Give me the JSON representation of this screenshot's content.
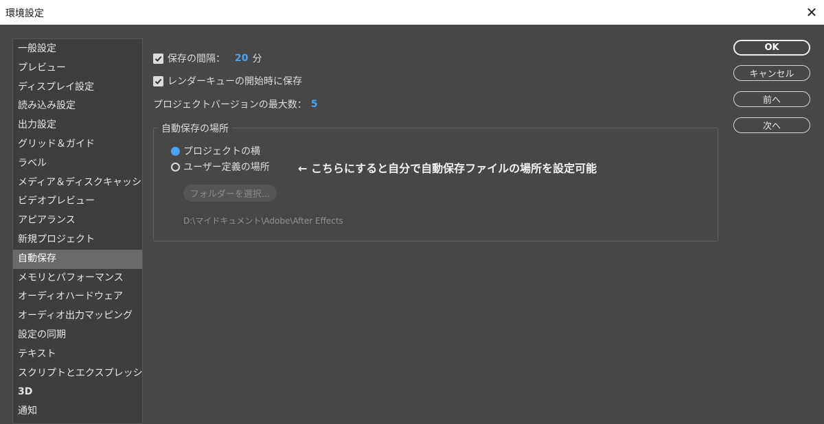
{
  "window": {
    "title": "環境設定",
    "close_glyph": "✕"
  },
  "sidebar": {
    "items": [
      {
        "label": "一般設定"
      },
      {
        "label": "プレビュー"
      },
      {
        "label": "ディスプレイ設定"
      },
      {
        "label": "読み込み設定"
      },
      {
        "label": "出力設定"
      },
      {
        "label": "グリッド＆ガイド"
      },
      {
        "label": "ラベル"
      },
      {
        "label": "メディア＆ディスクキャッシュ"
      },
      {
        "label": "ビデオプレビュー"
      },
      {
        "label": "アピアランス"
      },
      {
        "label": "新規プロジェクト"
      },
      {
        "label": "自動保存",
        "selected": true
      },
      {
        "label": "メモリとパフォーマンス"
      },
      {
        "label": "オーディオハードウェア"
      },
      {
        "label": "オーディオ出力マッピング"
      },
      {
        "label": "設定の同期"
      },
      {
        "label": "テキスト"
      },
      {
        "label": "スクリプトとエクスプレッション"
      },
      {
        "label": "3D"
      },
      {
        "label": "通知"
      }
    ]
  },
  "autosave": {
    "interval": {
      "checked": true,
      "label": "保存の間隔：",
      "value": "20",
      "unit": "分"
    },
    "on_render_start": {
      "checked": true,
      "label": "レンダーキューの開始時に保存"
    },
    "max_versions": {
      "label": "プロジェクトバージョンの最大数：",
      "value": "5"
    },
    "location": {
      "legend": "自動保存の場所",
      "options": [
        {
          "label": "プロジェクトの横",
          "selected": true
        },
        {
          "label": "ユーザー定義の場所",
          "selected": false
        }
      ],
      "folder_button": "フォルダーを選択...",
      "path": "D:\\マイドキュメント\\Adobe\\After Effects"
    },
    "annotation": "← こちらにすると自分で自動保存ファイルの場所を設定可能"
  },
  "buttons": {
    "ok": "OK",
    "cancel": "キャンセル",
    "prev": "前へ",
    "next": "次へ"
  },
  "colors": {
    "accent": "#4aa3f0",
    "background": "#474747",
    "sidebar_selected": "#6a6a6a"
  }
}
